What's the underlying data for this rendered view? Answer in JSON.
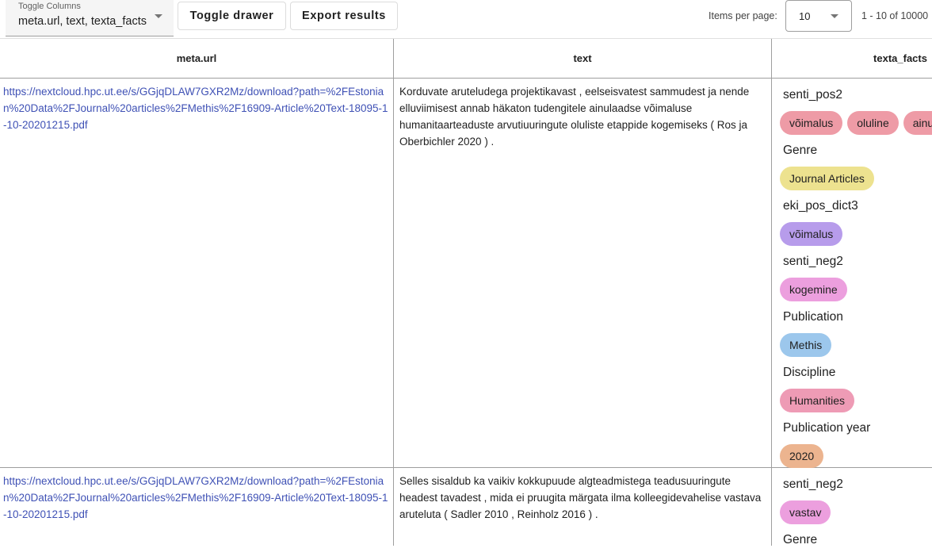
{
  "toolbar": {
    "toggle_columns_label": "Toggle Columns",
    "toggle_columns_value": "meta.url, text, texta_facts",
    "toggle_drawer": "Toggle drawer",
    "export_results": "Export results",
    "items_per_page_label": "Items per page:",
    "items_per_page_value": "10",
    "range": "1 - 10 of 10000"
  },
  "table": {
    "headers": [
      "meta.url",
      "text",
      "texta_facts"
    ],
    "rows": [
      {
        "url": "https://nextcloud.hpc.ut.ee/s/GGjqDLAW7GXR2Mz/download?path=%2FEstonian%20Data%2FJournal%20articles%2FMethis%2F16909-Article%20Text-18095-1-10-20201215.pdf",
        "text": "Korduvate aruteludega projektikavast , eelseisvatest sammudest ja nende elluviimisest annab häkaton tudengitele ainulaadse võimaluse humanitaarteaduste arvutiuuringute oluliste etappide kogemiseks ( Ros ja Oberbichler 2020 ) .",
        "facts": [
          {
            "name": "senti_pos2",
            "chips": [
              {
                "label": "võimalus",
                "color": "#ee9ba6"
              },
              {
                "label": "oluline",
                "color": "#ee9ba6"
              },
              {
                "label": "ainulaadne",
                "color": "#ee9ba6"
              }
            ]
          },
          {
            "name": "Genre",
            "chips": [
              {
                "label": "Journal Articles",
                "color": "#ede28f"
              }
            ]
          },
          {
            "name": "eki_pos_dict3",
            "chips": [
              {
                "label": "võimalus",
                "color": "#b79ceb"
              }
            ]
          },
          {
            "name": "senti_neg2",
            "chips": [
              {
                "label": "kogemine",
                "color": "#ec9fde"
              }
            ]
          },
          {
            "name": "Publication",
            "chips": [
              {
                "label": "Methis",
                "color": "#9cc7ec"
              }
            ]
          },
          {
            "name": "Discipline",
            "chips": [
              {
                "label": "Humanities",
                "color": "#ee9bb5"
              }
            ]
          },
          {
            "name": "Publication year",
            "chips": [
              {
                "label": "2020",
                "color": "#ecb48f"
              }
            ]
          }
        ]
      },
      {
        "url": "https://nextcloud.hpc.ut.ee/s/GGjqDLAW7GXR2Mz/download?path=%2FEstonian%20Data%2FJournal%20articles%2FMethis%2F16909-Article%20Text-18095-1-10-20201215.pdf",
        "text": "Selles sisaldub ka vaikiv kokkupuude algteadmistega teadusuuringute headest tavadest , mida ei pruugita märgata ilma kolleegidevahelise vastava aruteluta ( Sadler 2010 , Reinholz 2016 ) .",
        "facts": [
          {
            "name": "senti_neg2",
            "chips": [
              {
                "label": "vastav",
                "color": "#ec9fde"
              }
            ]
          },
          {
            "name": "Genre",
            "chips": []
          }
        ]
      }
    ]
  }
}
